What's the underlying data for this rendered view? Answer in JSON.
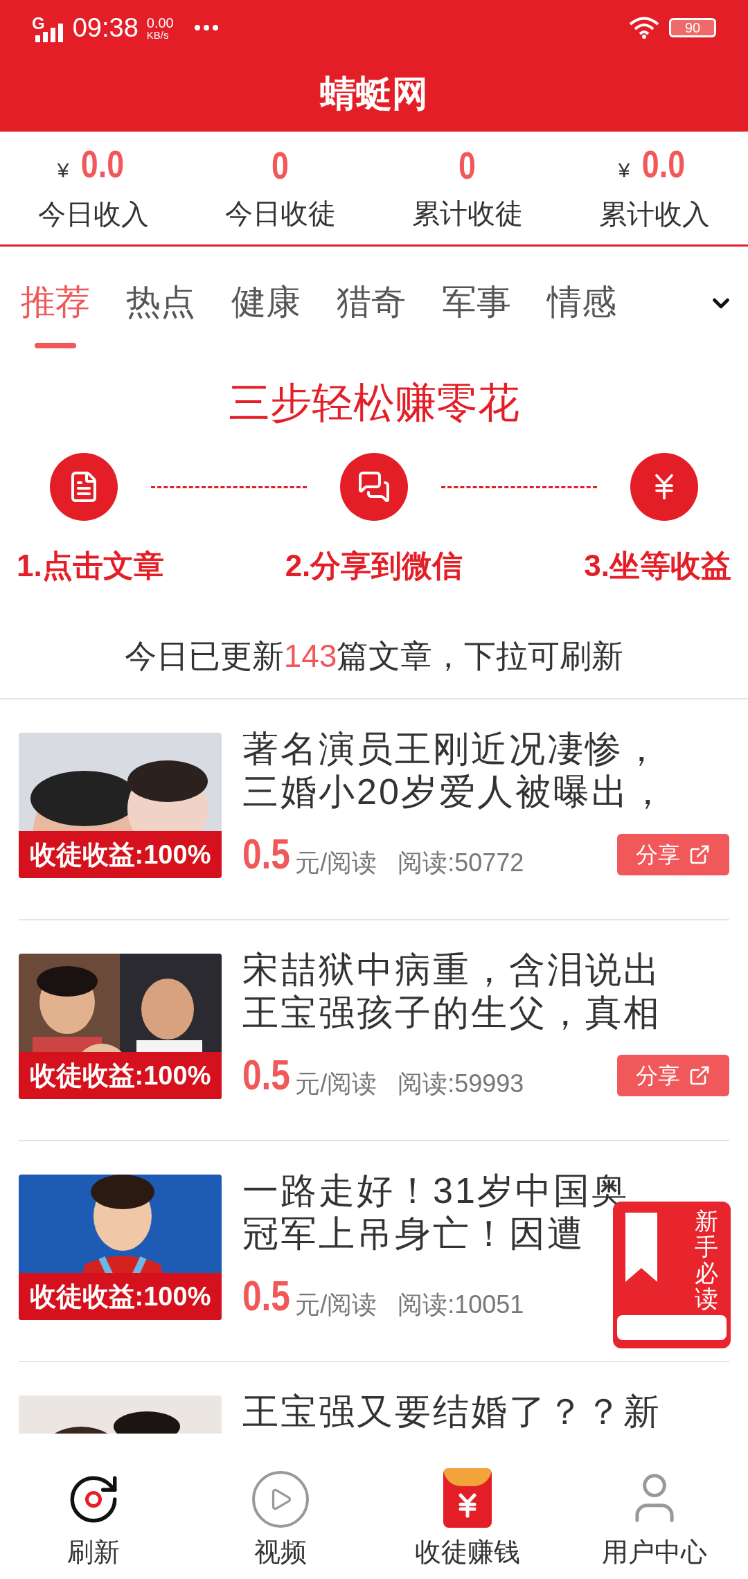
{
  "status_bar": {
    "network": "G",
    "time": "09:38",
    "speed": "0.00",
    "speed_unit": "KB/s",
    "battery": "90"
  },
  "title": "蜻蜓网",
  "stats": [
    {
      "prefix": "¥",
      "value": "0.0",
      "label": "今日收入"
    },
    {
      "value": "0",
      "label": "今日收徒"
    },
    {
      "value": "0",
      "label": "累计收徒"
    },
    {
      "prefix": "¥",
      "value": "0.0",
      "label": "累计收入"
    }
  ],
  "tabs": [
    {
      "label": "推荐",
      "selected": true
    },
    {
      "label": "热点",
      "selected": false
    },
    {
      "label": "健康",
      "selected": false
    },
    {
      "label": "猎奇",
      "selected": false
    },
    {
      "label": "军事",
      "selected": false
    },
    {
      "label": "情感",
      "selected": false
    }
  ],
  "steps": {
    "title": "三步轻松赚零花",
    "items": [
      {
        "kind": "article",
        "label": "1.点击文章"
      },
      {
        "kind": "wechat",
        "label": "2.分享到微信"
      },
      {
        "kind": "money",
        "label": "3.坐等收益"
      }
    ]
  },
  "update_notice": {
    "before": "今日已更新",
    "count": "143",
    "after": "篇文章，下拉可刷新"
  },
  "articles": [
    {
      "title_lines": [
        "著名演员王刚近况凄惨，",
        "三婚小20岁爱人被曝出，"
      ],
      "tag": "收徒收益:100%",
      "price": "0.5",
      "price_unit": "元/阅读",
      "reads": "阅读:50772",
      "share": "分享"
    },
    {
      "title_lines": [
        "宋喆狱中病重，含泪说出",
        "王宝强孩子的生父，真相"
      ],
      "tag": "收徒收益:100%",
      "price": "0.5",
      "price_unit": "元/阅读",
      "reads": "阅读:59993",
      "share": "分享"
    },
    {
      "title_lines": [
        "一路走好！31岁中国奥",
        "冠军上吊身亡！因遭"
      ],
      "tag": "收徒收益:100%",
      "price": "0.5",
      "price_unit": "元/阅读",
      "reads": "阅读:10051"
    },
    {
      "title_lines": [
        "王宝强又要结婚了？？新"
      ]
    }
  ],
  "floating_badge": {
    "label": "新手必读"
  },
  "bottom_nav": [
    {
      "kind": "refresh",
      "label": "刷新"
    },
    {
      "kind": "video",
      "label": "视频"
    },
    {
      "kind": "redpacket",
      "label": "收徒赚钱"
    },
    {
      "kind": "user",
      "label": "用户中心"
    }
  ]
}
